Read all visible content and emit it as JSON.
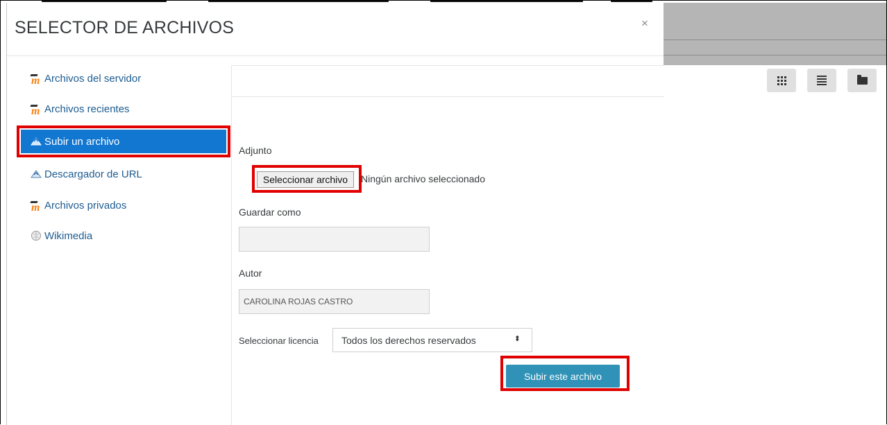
{
  "dialog": {
    "title": "SELECTOR DE ARCHIVOS",
    "close_label": "×"
  },
  "sidebar": {
    "items": [
      {
        "label": "Archivos del servidor",
        "icon": "moodle-icon"
      },
      {
        "label": "Archivos recientes",
        "icon": "moodle-icon"
      },
      {
        "label": "Subir un archivo",
        "icon": "upload-icon",
        "active": true
      },
      {
        "label": "Descargador de URL",
        "icon": "url-download-icon"
      },
      {
        "label": "Archivos privados",
        "icon": "moodle-icon"
      },
      {
        "label": "Wikimedia",
        "icon": "wikimedia-icon"
      }
    ]
  },
  "toolbar": {
    "views": [
      "grid-view-icon",
      "list-view-icon",
      "folder-view-icon"
    ]
  },
  "form": {
    "attachment_label": "Adjunto",
    "file_button_label": "Seleccionar archivo",
    "file_status": "Ningún archivo seleccionado",
    "save_as_label": "Guardar como",
    "save_as_value": "",
    "author_label": "Autor",
    "author_value": "CAROLINA ROJAS CASTRO",
    "license_label": "Seleccionar licencia",
    "license_value": "Todos los derechos reservados",
    "submit_label": "Subir este archivo"
  },
  "colors": {
    "active_item": "#1177d1",
    "submit_button": "#2f92b6",
    "highlight": "#e00000",
    "link": "#1d5c91"
  }
}
